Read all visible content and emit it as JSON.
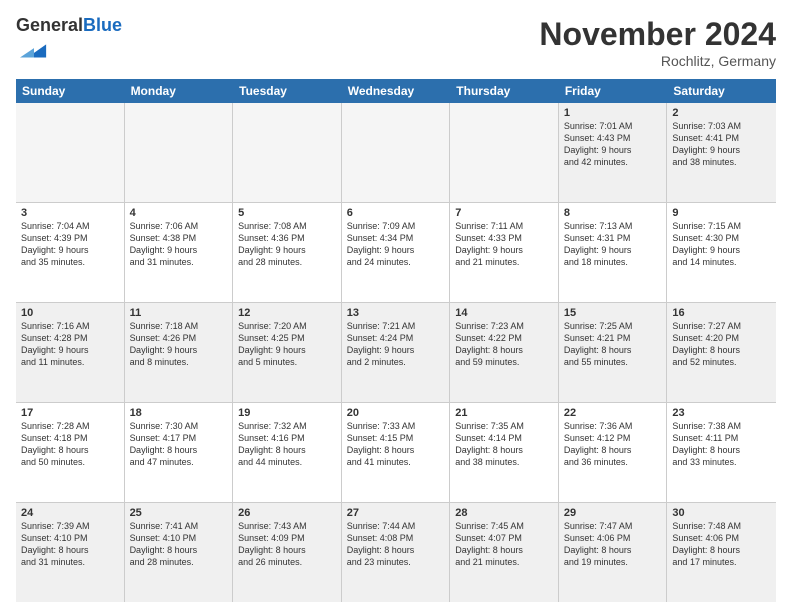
{
  "header": {
    "logo_general": "General",
    "logo_blue": "Blue",
    "month": "November 2024",
    "location": "Rochlitz, Germany"
  },
  "weekdays": [
    "Sunday",
    "Monday",
    "Tuesday",
    "Wednesday",
    "Thursday",
    "Friday",
    "Saturday"
  ],
  "rows": [
    [
      {
        "day": "",
        "info": "",
        "empty": true
      },
      {
        "day": "",
        "info": "",
        "empty": true
      },
      {
        "day": "",
        "info": "",
        "empty": true
      },
      {
        "day": "",
        "info": "",
        "empty": true
      },
      {
        "day": "",
        "info": "",
        "empty": true
      },
      {
        "day": "1",
        "info": "Sunrise: 7:01 AM\nSunset: 4:43 PM\nDaylight: 9 hours\nand 42 minutes.",
        "empty": false
      },
      {
        "day": "2",
        "info": "Sunrise: 7:03 AM\nSunset: 4:41 PM\nDaylight: 9 hours\nand 38 minutes.",
        "empty": false
      }
    ],
    [
      {
        "day": "3",
        "info": "Sunrise: 7:04 AM\nSunset: 4:39 PM\nDaylight: 9 hours\nand 35 minutes.",
        "empty": false
      },
      {
        "day": "4",
        "info": "Sunrise: 7:06 AM\nSunset: 4:38 PM\nDaylight: 9 hours\nand 31 minutes.",
        "empty": false
      },
      {
        "day": "5",
        "info": "Sunrise: 7:08 AM\nSunset: 4:36 PM\nDaylight: 9 hours\nand 28 minutes.",
        "empty": false
      },
      {
        "day": "6",
        "info": "Sunrise: 7:09 AM\nSunset: 4:34 PM\nDaylight: 9 hours\nand 24 minutes.",
        "empty": false
      },
      {
        "day": "7",
        "info": "Sunrise: 7:11 AM\nSunset: 4:33 PM\nDaylight: 9 hours\nand 21 minutes.",
        "empty": false
      },
      {
        "day": "8",
        "info": "Sunrise: 7:13 AM\nSunset: 4:31 PM\nDaylight: 9 hours\nand 18 minutes.",
        "empty": false
      },
      {
        "day": "9",
        "info": "Sunrise: 7:15 AM\nSunset: 4:30 PM\nDaylight: 9 hours\nand 14 minutes.",
        "empty": false
      }
    ],
    [
      {
        "day": "10",
        "info": "Sunrise: 7:16 AM\nSunset: 4:28 PM\nDaylight: 9 hours\nand 11 minutes.",
        "empty": false
      },
      {
        "day": "11",
        "info": "Sunrise: 7:18 AM\nSunset: 4:26 PM\nDaylight: 9 hours\nand 8 minutes.",
        "empty": false
      },
      {
        "day": "12",
        "info": "Sunrise: 7:20 AM\nSunset: 4:25 PM\nDaylight: 9 hours\nand 5 minutes.",
        "empty": false
      },
      {
        "day": "13",
        "info": "Sunrise: 7:21 AM\nSunset: 4:24 PM\nDaylight: 9 hours\nand 2 minutes.",
        "empty": false
      },
      {
        "day": "14",
        "info": "Sunrise: 7:23 AM\nSunset: 4:22 PM\nDaylight: 8 hours\nand 59 minutes.",
        "empty": false
      },
      {
        "day": "15",
        "info": "Sunrise: 7:25 AM\nSunset: 4:21 PM\nDaylight: 8 hours\nand 55 minutes.",
        "empty": false
      },
      {
        "day": "16",
        "info": "Sunrise: 7:27 AM\nSunset: 4:20 PM\nDaylight: 8 hours\nand 52 minutes.",
        "empty": false
      }
    ],
    [
      {
        "day": "17",
        "info": "Sunrise: 7:28 AM\nSunset: 4:18 PM\nDaylight: 8 hours\nand 50 minutes.",
        "empty": false
      },
      {
        "day": "18",
        "info": "Sunrise: 7:30 AM\nSunset: 4:17 PM\nDaylight: 8 hours\nand 47 minutes.",
        "empty": false
      },
      {
        "day": "19",
        "info": "Sunrise: 7:32 AM\nSunset: 4:16 PM\nDaylight: 8 hours\nand 44 minutes.",
        "empty": false
      },
      {
        "day": "20",
        "info": "Sunrise: 7:33 AM\nSunset: 4:15 PM\nDaylight: 8 hours\nand 41 minutes.",
        "empty": false
      },
      {
        "day": "21",
        "info": "Sunrise: 7:35 AM\nSunset: 4:14 PM\nDaylight: 8 hours\nand 38 minutes.",
        "empty": false
      },
      {
        "day": "22",
        "info": "Sunrise: 7:36 AM\nSunset: 4:12 PM\nDaylight: 8 hours\nand 36 minutes.",
        "empty": false
      },
      {
        "day": "23",
        "info": "Sunrise: 7:38 AM\nSunset: 4:11 PM\nDaylight: 8 hours\nand 33 minutes.",
        "empty": false
      }
    ],
    [
      {
        "day": "24",
        "info": "Sunrise: 7:39 AM\nSunset: 4:10 PM\nDaylight: 8 hours\nand 31 minutes.",
        "empty": false
      },
      {
        "day": "25",
        "info": "Sunrise: 7:41 AM\nSunset: 4:10 PM\nDaylight: 8 hours\nand 28 minutes.",
        "empty": false
      },
      {
        "day": "26",
        "info": "Sunrise: 7:43 AM\nSunset: 4:09 PM\nDaylight: 8 hours\nand 26 minutes.",
        "empty": false
      },
      {
        "day": "27",
        "info": "Sunrise: 7:44 AM\nSunset: 4:08 PM\nDaylight: 8 hours\nand 23 minutes.",
        "empty": false
      },
      {
        "day": "28",
        "info": "Sunrise: 7:45 AM\nSunset: 4:07 PM\nDaylight: 8 hours\nand 21 minutes.",
        "empty": false
      },
      {
        "day": "29",
        "info": "Sunrise: 7:47 AM\nSunset: 4:06 PM\nDaylight: 8 hours\nand 19 minutes.",
        "empty": false
      },
      {
        "day": "30",
        "info": "Sunrise: 7:48 AM\nSunset: 4:06 PM\nDaylight: 8 hours\nand 17 minutes.",
        "empty": false
      }
    ]
  ]
}
